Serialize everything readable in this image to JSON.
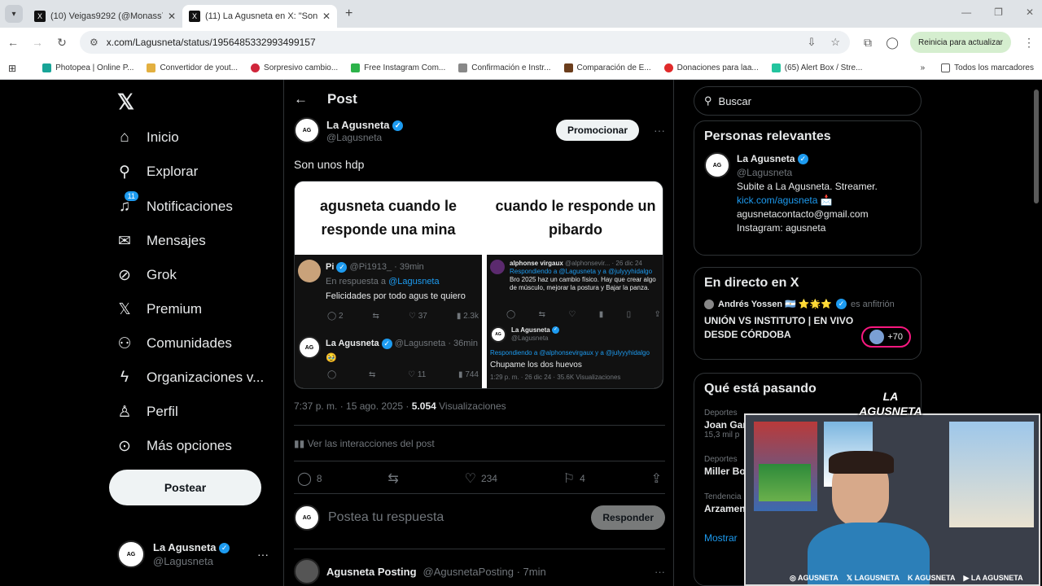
{
  "browser": {
    "tabs": [
      {
        "title": "(10) Veigas9292 (@Monass718",
        "active": false
      },
      {
        "title": "(11) La Agusneta en X: \"Son unos",
        "active": true
      }
    ],
    "url": "x.com/Lagusneta/status/1956485332993499157",
    "update_label": "Reinicia para actualizar",
    "bookmarks": [
      "Photopea | Online P...",
      "Convertidor de yout...",
      "Sorpresivo cambio...",
      "Free Instagram Com...",
      "Confirmación e Instr...",
      "Comparación de E...",
      "Donaciones para laa...",
      "(65) Alert Box / Stre..."
    ],
    "all_bookmarks": "Todos los marcadores"
  },
  "nav": {
    "items": [
      {
        "label": "Inicio",
        "icon": "home-icon",
        "glyph": "⌂"
      },
      {
        "label": "Explorar",
        "icon": "search-icon",
        "glyph": "⌕"
      },
      {
        "label": "Notificaciones",
        "icon": "bell-icon",
        "glyph": "🔔︎",
        "badge": "11"
      },
      {
        "label": "Mensajes",
        "icon": "mail-icon",
        "glyph": "✉"
      },
      {
        "label": "Grok",
        "icon": "grok-icon",
        "glyph": "⊘"
      },
      {
        "label": "Premium",
        "icon": "x-premium-icon",
        "glyph": "✕"
      },
      {
        "label": "Comunidades",
        "icon": "communities-icon",
        "glyph": "⚇"
      },
      {
        "label": "Organizaciones v...",
        "icon": "lightning-icon",
        "glyph": "ϟ"
      },
      {
        "label": "Perfil",
        "icon": "person-icon",
        "glyph": "♙"
      },
      {
        "label": "Más opciones",
        "icon": "more-circle-icon",
        "glyph": "⊙"
      }
    ],
    "post_button": "Postear",
    "me": {
      "name": "La Agusneta",
      "handle": "@Lagusneta"
    }
  },
  "post": {
    "header": "Post",
    "author_name": "La Agusneta",
    "author_handle": "@Lagusneta",
    "promote": "Promocionar",
    "text": "Son unos hdp",
    "meme": {
      "left_caption": "agusneta cuando le responde una mina",
      "right_caption": "cuando le responde un pibardo",
      "left_reply1_name": "Pi",
      "left_reply1_handle": "@Pi1913_ · 39min",
      "left_reply1_inreply": "En respuesta a",
      "left_reply1_inreply_handle": "@Lagusneta",
      "left_reply1_text": "Felicidades por todo agus te quiero",
      "left_reply1_counts": [
        "2",
        "",
        "37",
        "2.3k"
      ],
      "left_reply2_name": "La Agusneta",
      "left_reply2_handle": "@Lagusneta · 36min",
      "left_reply2_text": "🥹",
      "left_reply2_counts": [
        "",
        "",
        "11",
        "744"
      ],
      "right_reply1_name": "alphonse virgaux",
      "right_reply1_handle": "@alphonsevir... · 26 dic 24",
      "right_reply1_inreply": "Respondiendo a @Lagusneta y a @julyyyhidalgo",
      "right_reply1_text": "Bro 2025 haz un cambio físico. Hay que crear algo de músculo, mejorar la postura y Bajar la panza.",
      "right_reply2_name": "La Agusneta",
      "right_reply2_handle": "@Lagusneta",
      "right_reply2_inreply": "Respondiendo a @alphonsevirgaux y a @julyyyhidalgo",
      "right_reply2_text": "Chupame los dos huevos",
      "right_reply2_meta": "1:29 p. m. · 26 dic 24 · 35.6K Visualizaciones"
    },
    "timestamp": "7:37 p. m. · 15 ago. 2025 · ",
    "views": "5.054",
    "views_label": " Visualizaciones",
    "interactions": "Ver las interacciones del post",
    "counts": {
      "replies": "8",
      "reposts": "",
      "likes": "234",
      "bookmarks": "4"
    },
    "reply_placeholder": "Postea tu respuesta",
    "reply_button": "Responder",
    "next_post": {
      "name": "Agusneta Posting",
      "handle": "@AgusnetaPosting · 7min"
    }
  },
  "sidebar": {
    "search_placeholder": "Buscar",
    "relevant": {
      "title": "Personas relevantes",
      "name": "La Agusneta",
      "handle": "@Lagusneta",
      "bio1": "Subite a La Agusneta. Streamer.",
      "bio2": "kick.com/agusneta 📩",
      "bio3": "agusnetacontacto@gmail.com",
      "bio4": "Instagram: agusneta"
    },
    "live": {
      "title": "En directo en X",
      "host": "Andrés Yossen 🇦🇷 ⭐🌟⭐",
      "host_suffix": "es anfitrión",
      "event": "UNIÓN VS INSTITUTO | EN VIVO DESDE CÓRDOBA",
      "count": "+70"
    },
    "trends": {
      "title": "Qué está pasando",
      "items": [
        {
          "category": "Deportes",
          "name": "Joan Gar",
          "posts": "15,3 mil p"
        },
        {
          "category": "Deportes",
          "name": "Miller Bo",
          "posts": ""
        },
        {
          "category": "Tendencia",
          "name": "Arzamen",
          "posts": ""
        }
      ],
      "show_more": "Mostrar"
    }
  },
  "overlay": {
    "logo": "LA AGUSNETA",
    "socials": [
      "AGUSNETA",
      "LAGUSNETA",
      "AGUSNETA",
      "LA AGUSNETA"
    ]
  }
}
